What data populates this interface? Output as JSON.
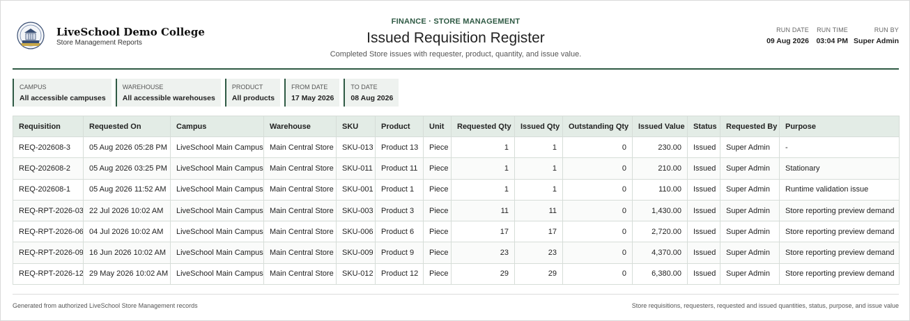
{
  "org": {
    "name": "LiveSchool Demo College",
    "subtitle": "Store Management Reports"
  },
  "report": {
    "eyebrow": "FINANCE · STORE MANAGEMENT",
    "title": "Issued Requisition Register",
    "subtitle": "Completed Store issues with requester, product, quantity, and issue value."
  },
  "meta": {
    "run_date_label": "RUN DATE",
    "run_date": "09 Aug 2026",
    "run_time_label": "RUN TIME",
    "run_time": "03:04 PM",
    "run_by_label": "RUN BY",
    "run_by": "Super Admin"
  },
  "filters": [
    {
      "label": "CAMPUS",
      "value": "All accessible campuses"
    },
    {
      "label": "WAREHOUSE",
      "value": "All accessible warehouses"
    },
    {
      "label": "PRODUCT",
      "value": "All products"
    },
    {
      "label": "FROM DATE",
      "value": "17 May 2026"
    },
    {
      "label": "TO DATE",
      "value": "08 Aug 2026"
    }
  ],
  "table": {
    "columns": [
      "Requisition",
      "Requested On",
      "Campus",
      "Warehouse",
      "SKU",
      "Product",
      "Unit",
      "Requested Qty",
      "Issued Qty",
      "Outstanding Qty",
      "Issued Value",
      "Status",
      "Requested By",
      "Purpose"
    ],
    "rows": [
      [
        "REQ-202608-3",
        "05 Aug 2026 05:28 PM",
        "LiveSchool Main Campus",
        "Main Central Store",
        "SKU-013",
        "Product 13",
        "Piece",
        "1",
        "1",
        "0",
        "230.00",
        "Issued",
        "Super Admin",
        "-"
      ],
      [
        "REQ-202608-2",
        "05 Aug 2026 03:25 PM",
        "LiveSchool Main Campus",
        "Main Central Store",
        "SKU-011",
        "Product 11",
        "Piece",
        "1",
        "1",
        "0",
        "210.00",
        "Issued",
        "Super Admin",
        "Stationary"
      ],
      [
        "REQ-202608-1",
        "05 Aug 2026 11:52 AM",
        "LiveSchool Main Campus",
        "Main Central Store",
        "SKU-001",
        "Product 1",
        "Piece",
        "1",
        "1",
        "0",
        "110.00",
        "Issued",
        "Super Admin",
        "Runtime validation issue"
      ],
      [
        "REQ-RPT-2026-03",
        "22 Jul 2026 10:02 AM",
        "LiveSchool Main Campus",
        "Main Central Store",
        "SKU-003",
        "Product 3",
        "Piece",
        "11",
        "11",
        "0",
        "1,430.00",
        "Issued",
        "Super Admin",
        "Store reporting preview demand"
      ],
      [
        "REQ-RPT-2026-06",
        "04 Jul 2026 10:02 AM",
        "LiveSchool Main Campus",
        "Main Central Store",
        "SKU-006",
        "Product 6",
        "Piece",
        "17",
        "17",
        "0",
        "2,720.00",
        "Issued",
        "Super Admin",
        "Store reporting preview demand"
      ],
      [
        "REQ-RPT-2026-09",
        "16 Jun 2026 10:02 AM",
        "LiveSchool Main Campus",
        "Main Central Store",
        "SKU-009",
        "Product 9",
        "Piece",
        "23",
        "23",
        "0",
        "4,370.00",
        "Issued",
        "Super Admin",
        "Store reporting preview demand"
      ],
      [
        "REQ-RPT-2026-12",
        "29 May 2026 10:02 AM",
        "LiveSchool Main Campus",
        "Main Central Store",
        "SKU-012",
        "Product 12",
        "Piece",
        "29",
        "29",
        "0",
        "6,380.00",
        "Issued",
        "Super Admin",
        "Store reporting preview demand"
      ]
    ]
  },
  "footer": {
    "left": "Generated from authorized LiveSchool Store Management records",
    "right": "Store requisitions, requesters, requested and issued quantities, status, purpose, and issue value"
  },
  "colors": {
    "accent": "#2f5a44",
    "header_bg": "#e3ece6",
    "filter_bg": "#eef2ef"
  },
  "icons": {
    "logo": "college-crest-icon"
  }
}
